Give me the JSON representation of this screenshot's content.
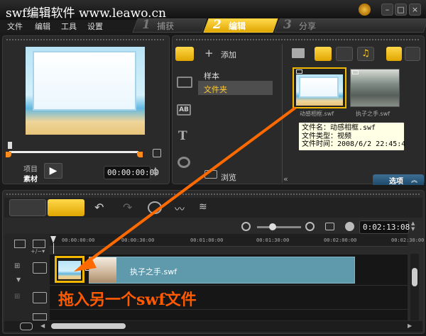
{
  "window": {
    "title": "swf编辑软件 www.leawo.cn",
    "minimize_label": "–",
    "maximize_label": "□",
    "close_label": "×"
  },
  "menu": {
    "items": [
      "文件",
      "编辑",
      "工具",
      "设置"
    ]
  },
  "steps": [
    {
      "num": "1",
      "label": "捕获",
      "active": false
    },
    {
      "num": "2",
      "label": "编辑",
      "active": true
    },
    {
      "num": "3",
      "label": "分享",
      "active": false
    }
  ],
  "preview": {
    "mode_project": "项目",
    "mode_clip": "素材",
    "timecode": "00:00:00:00",
    "play_label": "▶"
  },
  "library_nav": {
    "add_label": "添加",
    "folders": [
      "样本",
      "文件夹"
    ],
    "selected_folder": "文件夹",
    "browse_label": "浏览",
    "options_label": "选项"
  },
  "library_items": [
    {
      "name": "动感相框.swf",
      "selected": true
    },
    {
      "name": "执子之手.swf",
      "selected": false
    }
  ],
  "tooltip": {
    "line1": "文件名：动感相框.swf",
    "line2": "文件类型：视频",
    "line3": "文件时间：2008/6/2 22:45:4"
  },
  "timeline": {
    "timecode": "0:02:13:08",
    "ruler": [
      "00:00:00:00",
      "00:00:30:00",
      "00:01:00:00",
      "00:01:30:00",
      "00:02:00:00",
      "00:02:30:00"
    ],
    "clip_label": "执子之手.swf",
    "annotation": "拖入另一个swf文件",
    "zoom_level": 0.35
  },
  "colors": {
    "accent": "#f5b800",
    "arrow": "#ff6a00",
    "clip_bar": "#5f99ac",
    "annotation_text": "#ff5a00"
  }
}
